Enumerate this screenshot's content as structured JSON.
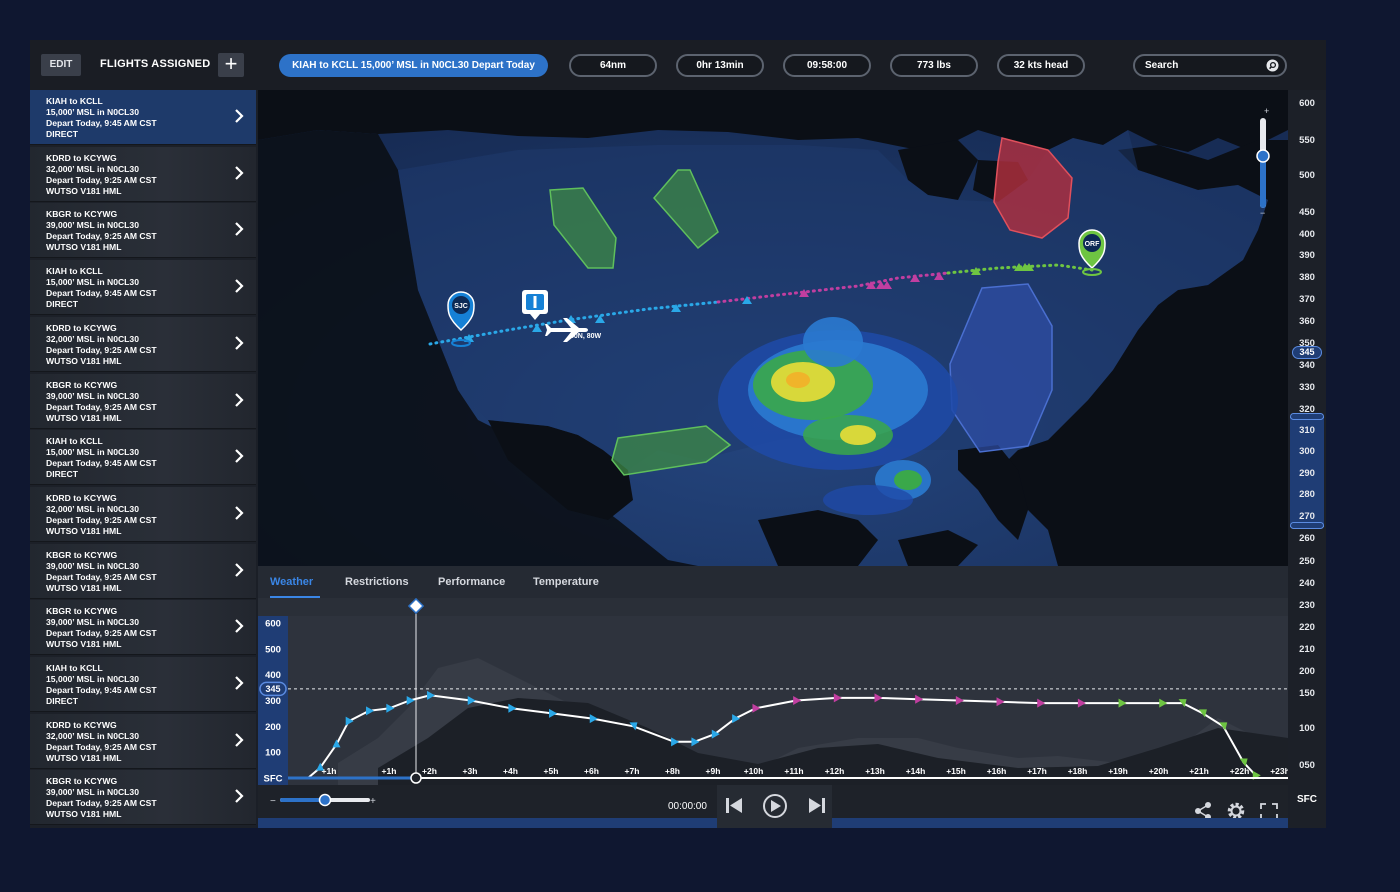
{
  "topbar": {
    "edit_label": "EDIT",
    "flights_title": "FLIGHTS ASSIGNED",
    "add_symbol": "+",
    "route_summary": "KIAH to KCLL 15,000’ MSL in N0CL30 Depart Today",
    "distance": "64nm",
    "duration": "0hr 13min",
    "time": "09:58:00",
    "fuel": "773 lbs",
    "wind": "32 kts head",
    "search_placeholder": "Search"
  },
  "flights": [
    {
      "route": "KIAH to KCLL",
      "altitude": "15,000’ MSL in N0CL30",
      "depart": "Depart Today, 9:45 AM CST",
      "via": "DIRECT",
      "active": true
    },
    {
      "route": "KDRD to KCYWG",
      "altitude": "32,000’ MSL in N0CL30",
      "depart": "Depart Today, 9:25 AM CST",
      "via": "WUTSO V181 HML"
    },
    {
      "route": "KBGR to KCYWG",
      "altitude": "39,000’ MSL in N0CL30",
      "depart": "Depart Today, 9:25 AM CST",
      "via": "WUTSO V181 HML"
    },
    {
      "route": "KIAH to KCLL",
      "altitude": "15,000’ MSL in N0CL30",
      "depart": "Depart Today, 9:45 AM CST",
      "via": "DIRECT"
    },
    {
      "route": "KDRD to KCYWG",
      "altitude": "32,000’ MSL in N0CL30",
      "depart": "Depart Today, 9:25 AM CST",
      "via": "WUTSO V181 HML"
    },
    {
      "route": "KBGR to KCYWG",
      "altitude": "39,000’ MSL in N0CL30",
      "depart": "Depart Today, 9:25 AM CST",
      "via": "WUTSO V181 HML"
    },
    {
      "route": "KIAH to KCLL",
      "altitude": "15,000’ MSL in N0CL30",
      "depart": "Depart Today, 9:45 AM CST",
      "via": "DIRECT"
    },
    {
      "route": "KDRD to KCYWG",
      "altitude": "32,000’ MSL in N0CL30",
      "depart": "Depart Today, 9:25 AM CST",
      "via": "WUTSO V181 HML"
    },
    {
      "route": "KBGR to KCYWG",
      "altitude": "39,000’ MSL in N0CL30",
      "depart": "Depart Today, 9:25 AM CST",
      "via": "WUTSO V181 HML"
    },
    {
      "route": "KBGR to KCYWG",
      "altitude": "39,000’ MSL in N0CL30",
      "depart": "Depart Today, 9:25 AM CST",
      "via": "WUTSO V181 HML"
    },
    {
      "route": "KIAH to KCLL",
      "altitude": "15,000’ MSL in N0CL30",
      "depart": "Depart Today, 9:45 AM CST",
      "via": "DIRECT"
    },
    {
      "route": "KDRD to KCYWG",
      "altitude": "32,000’ MSL in N0CL30",
      "depart": "Depart Today, 9:25 AM CST",
      "via": "WUTSO V181 HML"
    },
    {
      "route": "KBGR to KCYWG",
      "altitude": "39,000’ MSL in N0CL30",
      "depart": "Depart Today, 9:25 AM CST",
      "via": "WUTSO V181 HML"
    }
  ],
  "map": {
    "origin_label": "SJC",
    "destination_label": "ORF",
    "aircraft_coords": "40N, 80W",
    "info_marker": "i",
    "zoom_plus": "+",
    "zoom_minus": "−",
    "colors": {
      "climb": "#2aa8e8",
      "cruise": "#c13ea0",
      "descent": "#6ec542",
      "restriction_red": "#c8323e",
      "restriction_blue": "#2f4fa8",
      "restriction_green": "#3d8a46"
    }
  },
  "altitude_scale": {
    "ticks": [
      "600",
      "550",
      "500",
      "450",
      "400",
      "390",
      "380",
      "370",
      "360",
      "350",
      "340",
      "330",
      "320",
      "310",
      "300",
      "290",
      "280",
      "270",
      "260",
      "250",
      "240",
      "230",
      "220",
      "210",
      "200",
      "150",
      "100",
      "050"
    ],
    "selected": "345",
    "bottom": "SFC"
  },
  "tabs": [
    {
      "label": "Weather",
      "active": true
    },
    {
      "label": "Restrictions"
    },
    {
      "label": "Performance"
    },
    {
      "label": "Temperature"
    }
  ],
  "profile": {
    "y_ticks": [
      "600",
      "500",
      "400",
      "300",
      "200",
      "100",
      "SFC"
    ],
    "selected_altitude": "345",
    "x_ticks": [
      "+1h",
      "+1h",
      "+2h",
      "+3h",
      "+4h",
      "+5h",
      "+6h",
      "+7h",
      "+8h",
      "+9h",
      "+10h",
      "+11h",
      "+12h",
      "+13h",
      "+14h",
      "+15h",
      "+16h",
      "+17h",
      "+18h",
      "+19h",
      "+20h",
      "+21h",
      "+22h",
      "+23h"
    ]
  },
  "chart_data": {
    "type": "line",
    "title": "",
    "xlabel": "",
    "ylabel": "",
    "ylim": [
      0,
      600
    ],
    "x": [
      0.3,
      0.7,
      1.0,
      1.5,
      2.0,
      2.5,
      3.0,
      4.0,
      5.0,
      6.0,
      7.0,
      8.0,
      9.0,
      9.5,
      10.0,
      10.5,
      11.0,
      12.0,
      13.0,
      14.0,
      15.0,
      16.0,
      17.0,
      18.0,
      19.0,
      20.0,
      21.0,
      21.5,
      22.0,
      22.5,
      23.0,
      23.3
    ],
    "series": [
      {
        "values": [
          40,
          130,
          220,
          260,
          270,
          300,
          320,
          300,
          270,
          250,
          230,
          200,
          140,
          140,
          170,
          230,
          270,
          300,
          310,
          310,
          305,
          300,
          295,
          290,
          290,
          290,
          290,
          290,
          250,
          200,
          60,
          10
        ]
      }
    ]
  },
  "playback": {
    "time": "00:00:00",
    "zoom_minus": "−",
    "zoom_plus": "+",
    "zoom_level": 0.5
  }
}
